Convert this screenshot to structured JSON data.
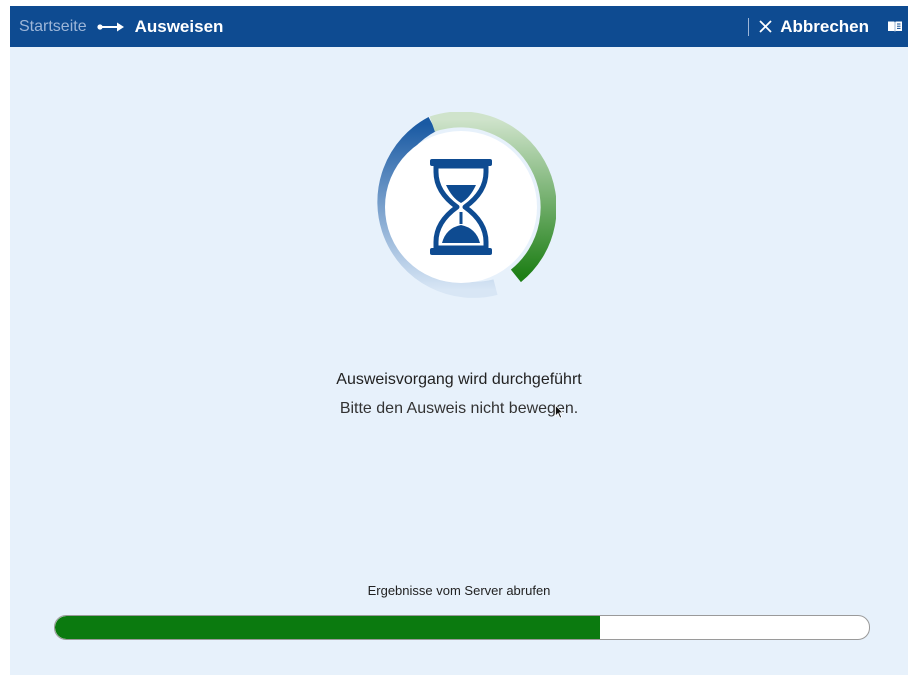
{
  "breadcrumb": {
    "home_label": "Startseite",
    "current_label": "Ausweisen"
  },
  "toolbar": {
    "cancel_label": "Abbrechen"
  },
  "icons": {
    "breadcrumb_separator": "arrow-right-icon",
    "cancel": "close-icon",
    "help": "book-icon",
    "status": "hourglass-icon",
    "cursor": "mouse-pointer-icon"
  },
  "status": {
    "title": "Ausweisvorgang wird durchgeführt",
    "subtitle": "Bitte den Ausweis nicht bewegen."
  },
  "progress": {
    "label": "Ergebnisse vom Server abrufen",
    "value_percent": 67
  },
  "colors": {
    "header_bg": "#0e4b91",
    "background": "#e7f1fb",
    "progress_fill": "#0b7a0f",
    "accent_blue": "#0e4b91",
    "accent_green": "#2f8a22"
  }
}
